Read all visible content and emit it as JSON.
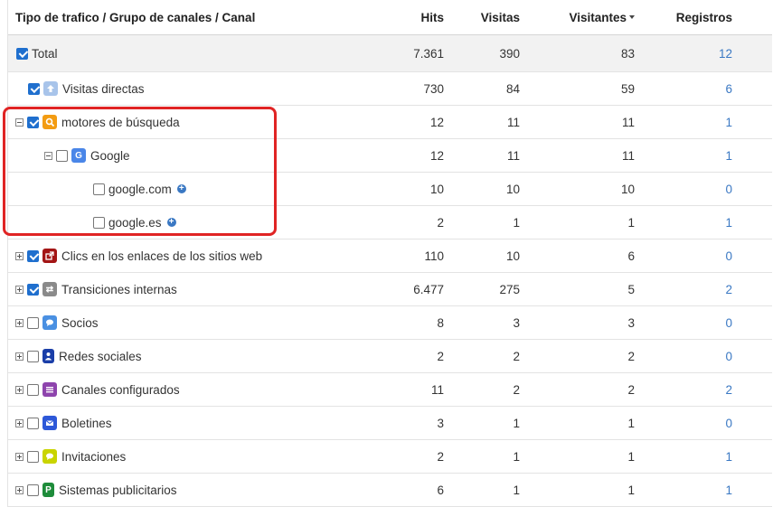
{
  "header": {
    "name": "Tipo de trafico / Grupo de canales / Canal",
    "hits": "Hits",
    "visitas": "Visitas",
    "visitantes": "Visitantes",
    "registros": "Registros"
  },
  "rows": [
    {
      "label": "Total",
      "hits": "7.361",
      "visitas": "390",
      "visitantes": "83",
      "registros": "12"
    },
    {
      "label": "Visitas directas",
      "hits": "730",
      "visitas": "84",
      "visitantes": "59",
      "registros": "6"
    },
    {
      "label": "motores de búsqueda",
      "hits": "12",
      "visitas": "11",
      "visitantes": "11",
      "registros": "1"
    },
    {
      "label": "Google",
      "hits": "12",
      "visitas": "11",
      "visitantes": "11",
      "registros": "1"
    },
    {
      "label": "google.com",
      "hits": "10",
      "visitas": "10",
      "visitantes": "10",
      "registros": "0"
    },
    {
      "label": "google.es",
      "hits": "2",
      "visitas": "1",
      "visitantes": "1",
      "registros": "1"
    },
    {
      "label": "Clics en los enlaces de los sitios web",
      "hits": "110",
      "visitas": "10",
      "visitantes": "6",
      "registros": "0"
    },
    {
      "label": "Transiciones internas",
      "hits": "6.477",
      "visitas": "275",
      "visitantes": "5",
      "registros": "2"
    },
    {
      "label": "Socios",
      "hits": "8",
      "visitas": "3",
      "visitantes": "3",
      "registros": "0"
    },
    {
      "label": "Redes sociales",
      "hits": "2",
      "visitas": "2",
      "visitantes": "2",
      "registros": "0"
    },
    {
      "label": "Canales configurados",
      "hits": "11",
      "visitas": "2",
      "visitantes": "2",
      "registros": "2"
    },
    {
      "label": "Boletines",
      "hits": "3",
      "visitas": "1",
      "visitantes": "1",
      "registros": "0"
    },
    {
      "label": "Invitaciones",
      "hits": "2",
      "visitas": "1",
      "visitantes": "1",
      "registros": "1"
    },
    {
      "label": "Sistemas publicitarios",
      "hits": "6",
      "visitas": "1",
      "visitantes": "1",
      "registros": "1"
    }
  ],
  "icons": {
    "direct": {
      "name": "direct-visit-icon",
      "color": "#a8c4ea"
    },
    "search": {
      "name": "search-icon",
      "color": "#f39c12"
    },
    "google": {
      "name": "google-icon",
      "color": "#4a86e8"
    },
    "links": {
      "name": "external-link-icon",
      "color": "#a31515"
    },
    "internal": {
      "name": "transfer-icon",
      "color": "#8a8a8a"
    },
    "partners": {
      "name": "chat-bubble-icon",
      "color": "#4a90e2"
    },
    "social": {
      "name": "person-icon",
      "color": "#1a3ea8"
    },
    "configured": {
      "name": "list-icon",
      "color": "#8e44ad"
    },
    "newsletters": {
      "name": "mail-icon",
      "color": "#2d58d8"
    },
    "invitations": {
      "name": "speech-icon",
      "color": "#c9d400"
    },
    "ads": {
      "name": "ads-p-icon",
      "color": "#1e8c3a"
    }
  },
  "colors": {
    "link": "#3a78c3",
    "checkbox": "#1f6fce",
    "highlight": "#e02424"
  }
}
